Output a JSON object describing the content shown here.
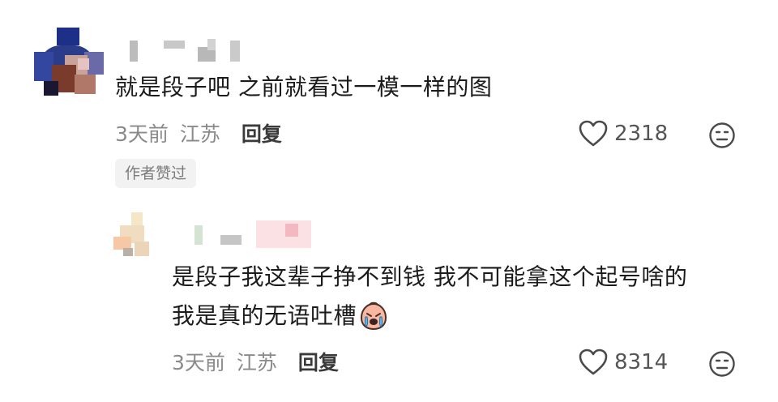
{
  "comment": {
    "text": "就是段子吧 之前就看过一模一样的图",
    "time": "3天前",
    "location": "江苏",
    "reply_label": "回复",
    "like_count": "2318",
    "author_badge": "作者赞过",
    "icons": {
      "like": "heart-outline-icon",
      "dislike": "neutral-face-icon"
    }
  },
  "reply": {
    "text_line1": "是段子我这辈子挣不到钱 我不可能拿这个起号啥的",
    "text_line2": "我是真的无语吐槽",
    "emoji": "crying-peach-emoji",
    "time": "3天前",
    "location": "江苏",
    "reply_label": "回复",
    "like_count": "8314",
    "icons": {
      "like": "heart-outline-icon",
      "dislike": "neutral-face-icon"
    }
  },
  "colors": {
    "text": "#1b1b1b",
    "meta": "#8a8a8a",
    "badge_bg": "#f2f2f2"
  }
}
